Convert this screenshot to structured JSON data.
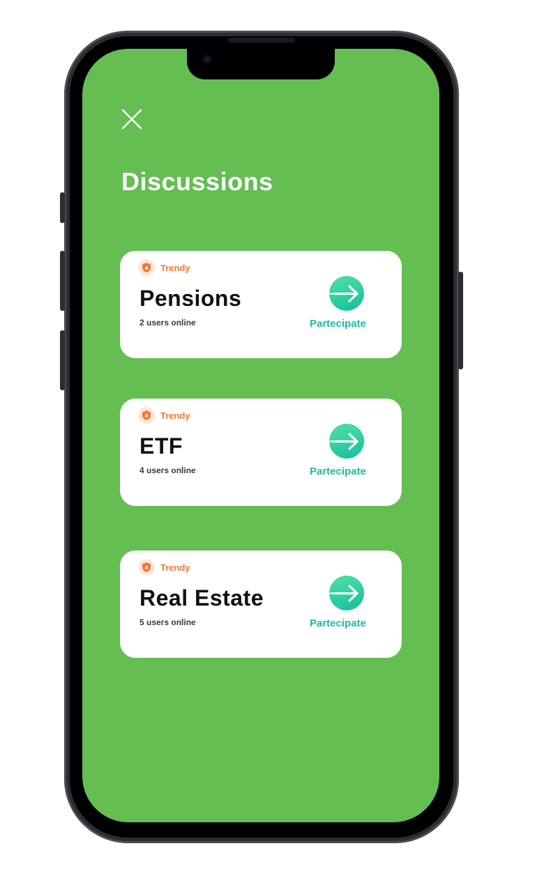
{
  "header": {
    "close_label": "close",
    "title": "Discussions"
  },
  "colors": {
    "screen_background": "#64be52",
    "card_background": "#ffffff",
    "trendy_accent": "#f07a3c",
    "action_accent": "#16bfa2"
  },
  "discussions": [
    {
      "badge": "Trendy",
      "topic": "Pensions",
      "online": "2 users online",
      "action": "Partecipate",
      "icon": "arrow-right-icon"
    },
    {
      "badge": "Trendy",
      "topic": "ETF",
      "online": "4 users online",
      "action": "Partecipate",
      "icon": "arrow-right-icon"
    },
    {
      "badge": "Trendy",
      "topic": "Real Estate",
      "online": "5 users online",
      "action": "Partecipate",
      "icon": "arrow-right-icon"
    }
  ]
}
